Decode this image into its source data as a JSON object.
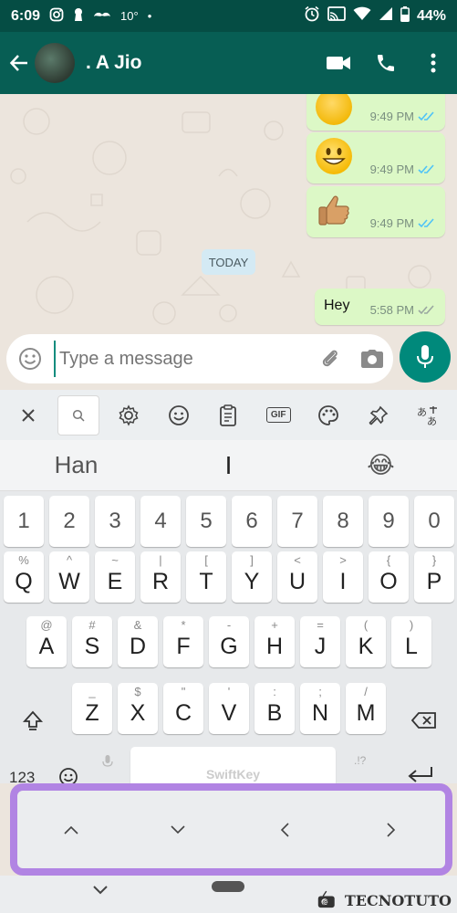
{
  "status_bar": {
    "time": "6:09",
    "temp": "10°",
    "battery": "44%"
  },
  "app_bar": {
    "contact_name": ". A Jio"
  },
  "chat": {
    "messages": [
      {
        "type": "emoji",
        "emoji": "thinking",
        "time": "9:49 PM"
      },
      {
        "type": "emoji",
        "emoji": "grinning",
        "time": "9:49 PM"
      },
      {
        "type": "emoji",
        "emoji": "thumbs-up",
        "time": "9:49 PM"
      },
      {
        "type": "text",
        "text": "Hey",
        "time": "5:58 PM"
      }
    ],
    "date_chip": "TODAY"
  },
  "composer": {
    "placeholder": "Type a message"
  },
  "keyboard": {
    "suggestions": [
      "Han",
      "I",
      "😂"
    ],
    "numbers": [
      "1",
      "2",
      "3",
      "4",
      "5",
      "6",
      "7",
      "8",
      "9",
      "0"
    ],
    "row1": [
      {
        "key": "Q",
        "sub": "%"
      },
      {
        "key": "W",
        "sub": "^"
      },
      {
        "key": "E",
        "sub": "~"
      },
      {
        "key": "R",
        "sub": "|"
      },
      {
        "key": "T",
        "sub": "["
      },
      {
        "key": "Y",
        "sub": "]"
      },
      {
        "key": "U",
        "sub": "<"
      },
      {
        "key": "I",
        "sub": ">"
      },
      {
        "key": "O",
        "sub": "{"
      },
      {
        "key": "P",
        "sub": "}"
      }
    ],
    "row2": [
      {
        "key": "A",
        "sub": "@"
      },
      {
        "key": "S",
        "sub": "#"
      },
      {
        "key": "D",
        "sub": "&"
      },
      {
        "key": "F",
        "sub": "*"
      },
      {
        "key": "G",
        "sub": "-"
      },
      {
        "key": "H",
        "sub": "+"
      },
      {
        "key": "J",
        "sub": "="
      },
      {
        "key": "K",
        "sub": "("
      },
      {
        "key": "L",
        "sub": ")"
      }
    ],
    "row3": [
      {
        "key": "Z",
        "sub": "_"
      },
      {
        "key": "X",
        "sub": "$"
      },
      {
        "key": "C",
        "sub": "\""
      },
      {
        "key": "V",
        "sub": "'"
      },
      {
        "key": "B",
        "sub": ":"
      },
      {
        "key": "N",
        "sub": ";"
      },
      {
        "key": "M",
        "sub": "/"
      }
    ],
    "numbers_label": "123",
    "space_label": "SwiftKey",
    "punct_label": ".!?",
    "gif_label": "GIF"
  },
  "watermark": {
    "text": "TECNOTUTO"
  }
}
